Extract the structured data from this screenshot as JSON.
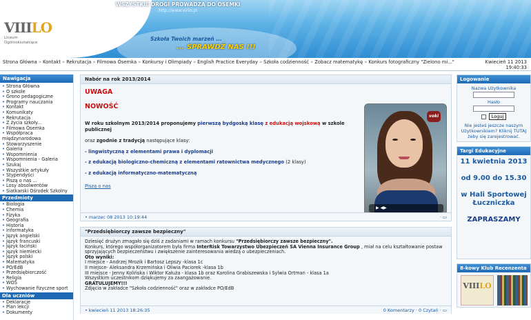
{
  "header": {
    "title": "WSZYSTKIE DROGI PROWADZĄ DO ÓSEMKI",
    "url": "http://www.viiilo.pl",
    "logo_main": "VIII",
    "logo_accent": "LO",
    "logo_sub1": "Liceum",
    "logo_sub2": "Ogólnokształcące",
    "slogan1": "Szkoła Twoich marzeń ...",
    "slogan2": "... SPRAWDŹ NAS !!!"
  },
  "menubar": {
    "items": [
      "Strona Główna",
      "Kontakt",
      "Rekrutacja",
      "Filmowa Ósemka",
      "Konkursy i Olimpiady",
      "English Practice Everyday",
      "Szkoła codzienność",
      "Zobacz matematykę",
      "Konkurs fotograficzny \"Zielono mi...\""
    ],
    "separator": "»",
    "date": "Kwiecień 11 2013",
    "time": "19:40:33"
  },
  "left": {
    "nav_title": "Nawigacja",
    "nav_items": [
      "Strona Główna",
      "O szkole",
      "Grono pedagogiczne",
      "Programy nauczania",
      "Kontakt",
      "Komunikaty",
      "Rekrutacja",
      "Z życia szkoły...",
      "Filmowa Ósemka",
      "Współpraca międzynarodowa",
      "Stowarzyszenie",
      "Galeria",
      "Wspomnienia",
      "Wspomnienia - Galeria",
      "Szukaj",
      "Wszystkie artykuły",
      "Stypendyści",
      "Piszą o nas ...",
      "Losy absolwentów",
      "Siatkarski Ośrodek Szkolny"
    ],
    "subjects_title": "Przedmioty",
    "subjects": [
      "Biologia",
      "Chemia",
      "Fizyka",
      "Geografia",
      "Historia",
      "Informatyka",
      "Język angielski",
      "Język francuski",
      "Język łaciński",
      "Język niemiecki",
      "Język polski",
      "Matematyka",
      "PO/EdB",
      "Przedsiębiorczość",
      "Religia",
      "WOS",
      "Wychowanie fizyczne sport"
    ],
    "students_title": "Dla uczniów",
    "students": [
      "Deklaracje",
      "Plan lekcji",
      "Dokumenty"
    ]
  },
  "article1": {
    "title": "Nabór na rok 2013/2014",
    "uwaga": "UWAGA",
    "nowosc": "NOWOŚĆ",
    "p1_a": "W roku szkolnym 2013/2014 proponujemy ",
    "p1_b": "pierwszą bydgoską klasę",
    "p1_c": " z edukacją wojskową",
    "p1_d": " w szkole publicznej",
    "p2_a": "oraz ",
    "p2_b": "zgodnie z tradycją",
    "p2_c": " następujące klasy:",
    "opt1": "- lingwistyczną z elementami prawa i dyplomacji",
    "opt2": "- z edukacją biologiczno-chemiczną z elementami ratownictwa medycznego",
    "opt2_note": " (2 klasy)",
    "opt3": "- z edukacją informatyczno-matematyczną",
    "link": "Piszą o nas",
    "footer": "• marzec 08 2013 10:19:44",
    "avatar_badge": "voki"
  },
  "article2": {
    "title": "\"Przedsiębiorczy zawsze bezpieczny\"",
    "line1_a": "Dziesięć drużyn zmagało się dziś z zadaniami w ramach konkursu ",
    "line1_b": "\"Przedsiębiorczy zawsze bezpieczny\".",
    "line2_a": "Konkurs, którego współorganizatorem była firma ",
    "line2_b": "InterRisk Towarzystwo Ubezpieczeń SA Vienna Insurance Group",
    "line2_c": " , miał na celu kształtowanie postaw sprzyjających bezpieczeństwu i zwiększenie zainteresowania wiedzą o ubezpieczeniach.",
    "results_label": "Oto wyniki:",
    "r1": "I miejsce - Andrzej Mrozik i Bartosz Lepszy -klasa 1c",
    "r2": "II miejsce- Aleksandra Krzemińska i Oliwia Paciorek -klasa 1b",
    "r3": "III miejsce - Jenny Kolińska i Wiktor Kałuża - klasa 1b oraz Karolina Grabiszewska i Sylwia Ortman - klasa 1a",
    "thanks": "Wszystkim uczestnikom dziękujemy za zaangażowanie.",
    "congrats": "GRATULUJEMY!!!",
    "photos": "Zdjęcia w zakładce \"Szkoła codzienność\" oraz w zakładce PO/EdB",
    "footer": "• kwiecień 11 2013 18:26:35",
    "footer_right": "0 Komentarzy · 0 Czytań ·"
  },
  "right": {
    "login_title": "Logowanie",
    "username_label": "Nazwa Użytkownika",
    "password_label": "Hasło",
    "login_button": "Loguj",
    "register_text": "Nie jesteś jeszcze naszym Użytkownikiem? Kliknij TUTAJ żeby się zarejestrować.",
    "fair_title": "Targi Edukacyjne",
    "fair_date": "11 kwietnia 2013",
    "fair_time": "od 9.00 do 15.30",
    "fair_place": "w Hali Sportowej Łuczniczka",
    "fair_invite": "ZAPRASZAMY",
    "club_title": "8-kowy Klub Recenzenta"
  }
}
